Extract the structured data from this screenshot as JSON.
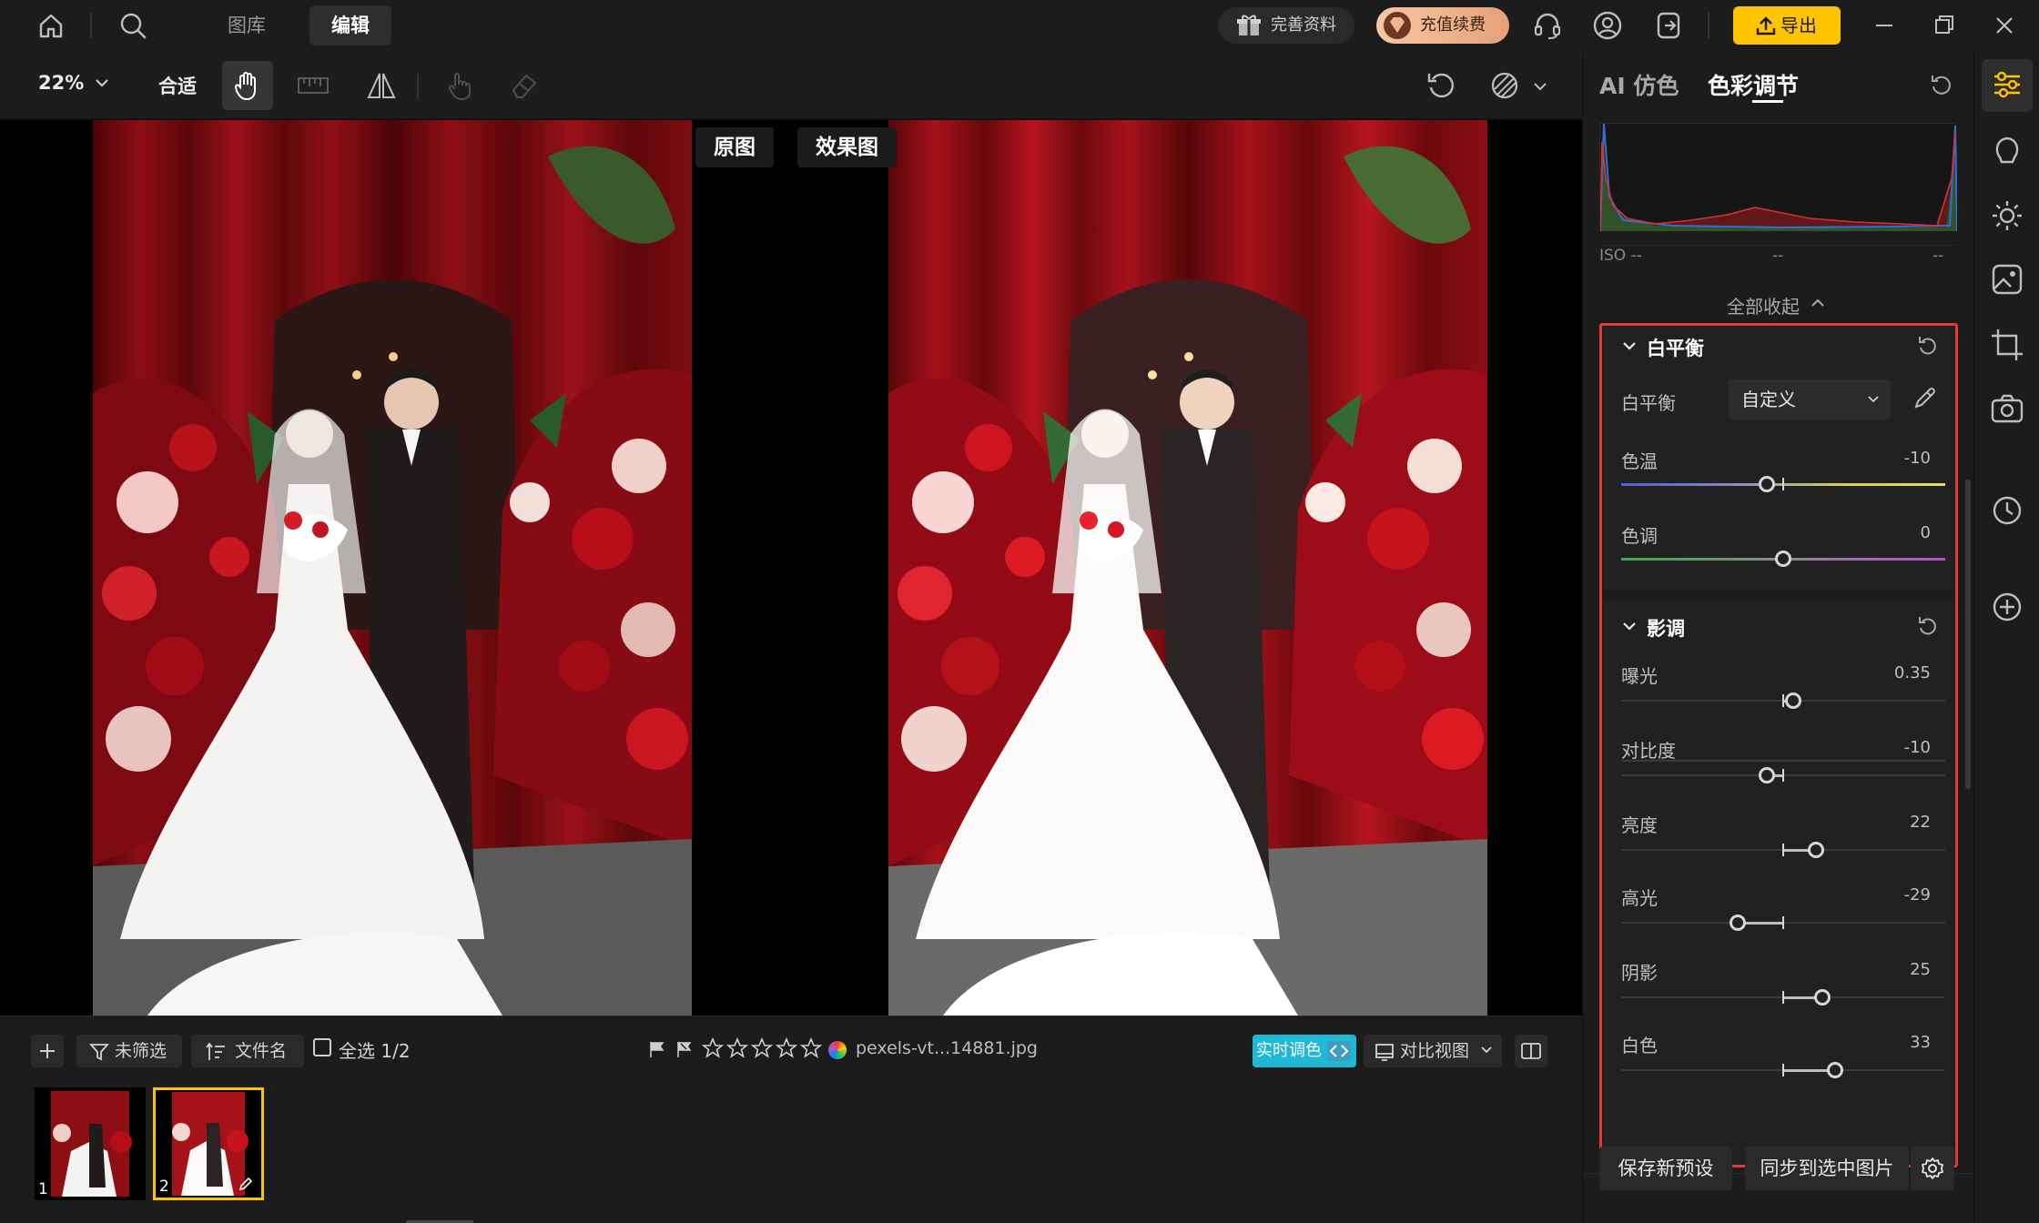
{
  "topbar": {
    "tabs": [
      {
        "label": "图库"
      },
      {
        "label": "编辑"
      }
    ],
    "profile_label": "完善资料",
    "renew_label": "充值续费",
    "export_label": "导出"
  },
  "toolbar": {
    "zoom": "22%",
    "fit_label": "合适"
  },
  "canvas": {
    "original_label": "原图",
    "effect_label": "效果图"
  },
  "filmstrip": {
    "filter_label": "未筛选",
    "sort_label": "文件名",
    "select_all_label": "全选 1/2",
    "filename": "pexels-vt...14881.jpg",
    "realtime_label": "实时调色",
    "compare_view_label": "对比视图",
    "thumbnails": [
      {
        "num": "1"
      },
      {
        "num": "2"
      }
    ]
  },
  "panel": {
    "tabs": [
      {
        "label": "AI 仿色"
      },
      {
        "label": "色彩调节"
      }
    ],
    "iso_label": "ISO --",
    "iso_mid": "--",
    "iso_right": "--",
    "collapse_all": "全部收起",
    "white_balance": {
      "title": "白平衡",
      "mode_label": "白平衡",
      "mode_value": "自定义",
      "sliders": [
        {
          "label": "色温",
          "value": "-10",
          "pos": 0.45
        },
        {
          "label": "色调",
          "value": "0",
          "pos": 0.5
        }
      ]
    },
    "tone": {
      "title": "影调",
      "sliders": [
        {
          "label": "曝光",
          "value": "0.35",
          "pos": 0.53
        },
        {
          "label": "对比度",
          "value": "-10",
          "pos": 0.45
        },
        {
          "label": "亮度",
          "value": "22",
          "pos": 0.6
        },
        {
          "label": "高光",
          "value": "-29",
          "pos": 0.36
        },
        {
          "label": "阴影",
          "value": "25",
          "pos": 0.62
        },
        {
          "label": "白色",
          "value": "33",
          "pos": 0.66
        }
      ]
    },
    "save_preset": "保存新预设",
    "sync_label": "同步到选中图片"
  },
  "colors": {
    "accent": "#ffc400",
    "highlight_border": "#e53935",
    "realtime_bg": "#1fb8d6"
  }
}
